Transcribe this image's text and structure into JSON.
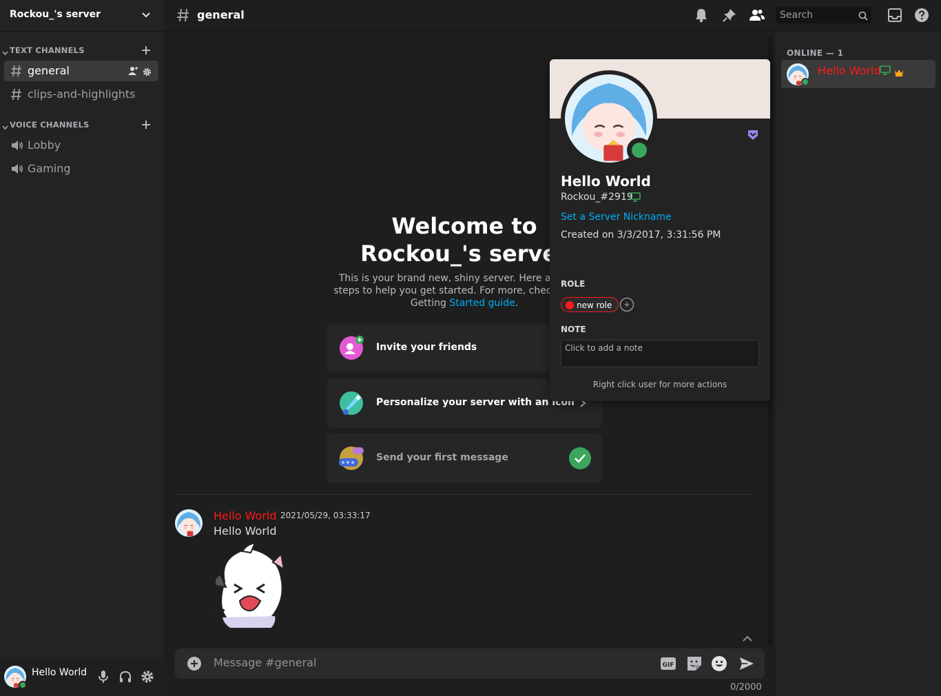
{
  "server": {
    "name": "Rockou_'s server"
  },
  "sidebar": {
    "categories": [
      {
        "label": "TEXT CHANNELS",
        "channels": [
          {
            "label": "general",
            "type": "text",
            "selected": true
          },
          {
            "label": "clips-and-highlights",
            "type": "text",
            "selected": false
          }
        ]
      },
      {
        "label": "VOICE CHANNELS",
        "channels": [
          {
            "label": "Lobby",
            "type": "voice"
          },
          {
            "label": "Gaming",
            "type": "voice"
          }
        ]
      }
    ]
  },
  "user_panel": {
    "name": "Hello World",
    "status": "online"
  },
  "header": {
    "channel": "general",
    "search_placeholder": "Search",
    "icons": [
      "bell-icon",
      "pin-icon",
      "members-icon",
      "search-icon",
      "inbox-icon",
      "help-icon"
    ]
  },
  "welcome": {
    "title_line1": "Welcome to",
    "title_line2": "Rockou_'s server",
    "desc_text": "This is your brand new, shiny server. Here are some steps to help you get started. For more, check out our Getting",
    "desc_link": "Started guide",
    "desc_end": ".",
    "cards": [
      {
        "label": "Invite your friends",
        "done": false
      },
      {
        "label": "Personalize your server with an icon",
        "done": false
      },
      {
        "label": "Send your first message",
        "done": true
      }
    ]
  },
  "message": {
    "author": "Hello World",
    "timestamp": "2021/05/29, 03:33:17",
    "text": "Hello World",
    "has_sticker": true
  },
  "composer": {
    "placeholder": "Message #general",
    "char_count": "0/2000",
    "icons": [
      "gif-icon",
      "sticker-icon",
      "emoji-icon",
      "send-icon"
    ]
  },
  "members": {
    "online_label": "ONLINE — 1",
    "list": [
      {
        "name": "Hello World",
        "status": "online",
        "owner": true,
        "desktop": true
      }
    ]
  },
  "profile": {
    "display_name": "Hello World",
    "tag": "Rockou_#2919",
    "nickname_link": "Set a Server Nickname",
    "created": "Created on 3/3/2017, 3:31:56 PM",
    "role_header": "ROLE",
    "role_name": "new role",
    "note_header": "NOTE",
    "note_placeholder": "Click to add a note",
    "hint": "Right click user for more actions"
  },
  "colors": {
    "accent_link": "#00aff4",
    "role_red": "#ff1a1a",
    "online_green": "#3ba55d",
    "banner": "#efe5e0",
    "hypesquad_purple": "#9b84ee"
  }
}
